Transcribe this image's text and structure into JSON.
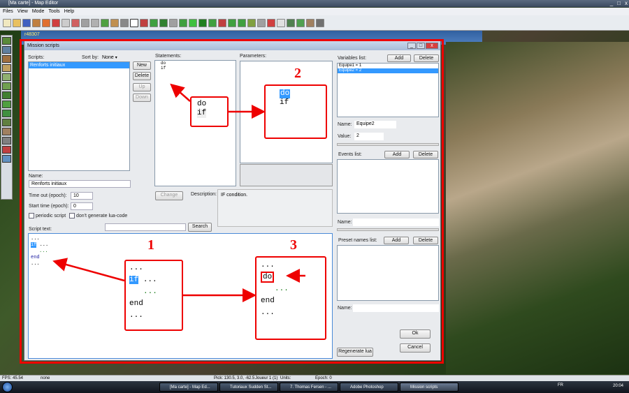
{
  "app": {
    "title": "[Ma carte] - Map Editor",
    "window_buttons": [
      "_",
      "□",
      "x"
    ]
  },
  "menu": [
    "Files",
    "View",
    "Mode",
    "Tools",
    "Help"
  ],
  "viewport": {
    "coord_text": "r48307"
  },
  "dialog": {
    "title": "Mission scripts",
    "scripts_label": "Scripts:",
    "sortby_label": "Sort by:",
    "sortby_value": "None",
    "scripts": [
      "Renforts initiaux"
    ],
    "btn_new": "New",
    "btn_delete": "Delete",
    "btn_up": "Up",
    "btn_down": "Down",
    "name_label": "Name:",
    "name_value": "Renforts initiaux",
    "timeout_label": "Time out (epoch):",
    "timeout_value": "10",
    "starttime_label": "Start time (epoch):",
    "starttime_value": "0",
    "periodic_label": "periodic script",
    "nolua_label": "don't generate lua-code",
    "scripttext_label": "Script text:",
    "search_btn": "Search",
    "statements_label": "Statements:",
    "statements": [
      "do",
      "if"
    ],
    "change_btn": "Change",
    "description_label": "Description:",
    "description_value": "IF condition.",
    "parameters_label": "Parameters:",
    "variables_label": "Variables list:",
    "add_label": "Add",
    "delete_label": "Delete",
    "variables": [
      "Equipe1 = 1",
      "Equipe2 = 2"
    ],
    "var_name_label": "Name:",
    "var_name_value": "Equipe2",
    "var_value_label": "Value:",
    "var_value_value": "2",
    "events_label": "Events list:",
    "events_name_label": "Name:",
    "preset_label": "Preset names list:",
    "preset_name_label": "Name:",
    "ok_btn": "Ok",
    "cancel_btn": "Cancel",
    "regen_btn": "Regenerate lua",
    "script_lines": [
      "...",
      "if",
      "...",
      "...",
      "end",
      "..."
    ]
  },
  "annotations": {
    "n1": "1",
    "n2": "2",
    "n3": "3",
    "callout_statements": [
      "do",
      "if"
    ],
    "callout_params": [
      "do",
      "if"
    ],
    "callout1": [
      "...",
      "if",
      "...",
      "...",
      "end",
      "..."
    ],
    "callout3": [
      "...",
      "do",
      "...",
      "end",
      "..."
    ]
  },
  "status": {
    "fps": "FPS: 45.54",
    "mode": "none",
    "pick": "Pick: 130.5, 3.0, -62.5",
    "player": "Joueur 1 (1)",
    "units": "Units:",
    "epoch": "Epoch: 0"
  },
  "taskbar": {
    "tasks": [
      "[Ma carte] - Map Ed...",
      "Tutoriaux Sudden St...",
      "7. Thomas Fersen - ...",
      "Adobe Photoshop",
      "Mission scripts"
    ],
    "lang": "FR",
    "clock": "20:04"
  },
  "colors": {
    "accent_red": "#ee0000",
    "selection_blue": "#3399ff"
  }
}
